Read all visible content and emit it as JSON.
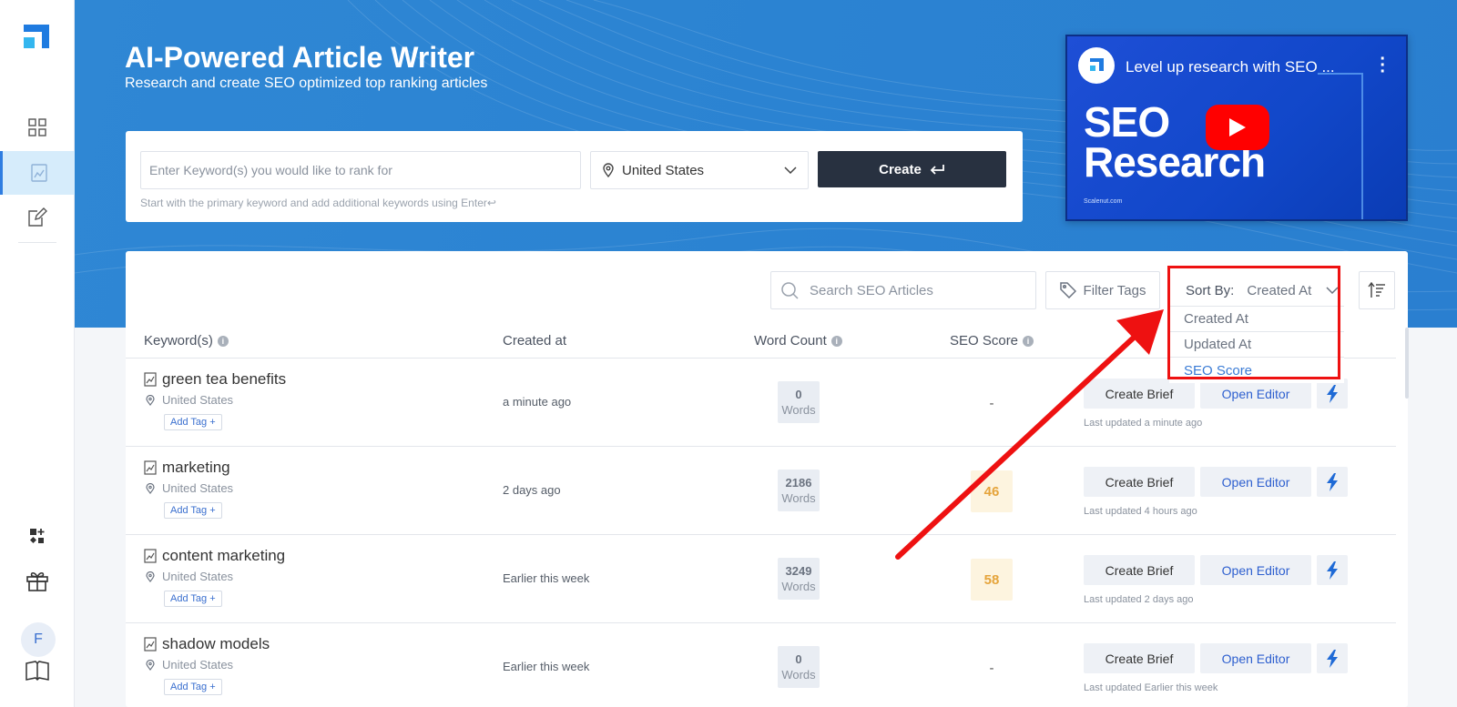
{
  "sidebar": {
    "items": [
      "dashboard",
      "ai-article-writer",
      "content-editor",
      "tools",
      "gift",
      "docs"
    ],
    "avatar": "F"
  },
  "hero": {
    "title": "AI-Powered Article Writer",
    "subtitle": "Research and create SEO optimized top ranking articles"
  },
  "create_form": {
    "keyword_placeholder": "Enter Keyword(s) you would like to rank for",
    "location": "United States",
    "create_label": "Create",
    "hint": "Start with the primary keyword and add additional keywords using Enter↩"
  },
  "video": {
    "title": "Level up research with SEO ...",
    "big_text_line1": "SEO",
    "big_text_line2": "Research",
    "small_text": "Scalenut.com",
    "channel_label": "nut"
  },
  "toolbar": {
    "search_placeholder": "Search SEO Articles",
    "filter_label": "Filter Tags",
    "sort_label": "Sort By:",
    "sort_value": "Created At",
    "sort_options": [
      "Created At",
      "Updated At",
      "SEO Score"
    ]
  },
  "table": {
    "headers": {
      "keyword": "Keyword(s)",
      "created": "Created at",
      "word_count": "Word Count",
      "seo_score": "SEO Score"
    },
    "add_tag_label": "Add Tag +",
    "words_label": "Words",
    "create_brief_label": "Create Brief",
    "open_editor_label": "Open Editor",
    "rows": [
      {
        "keyword": "green tea benefits",
        "location": "United States",
        "created": "a minute ago",
        "word_count": "0",
        "seo_score": "-",
        "updated": "Last updated a minute ago"
      },
      {
        "keyword": "marketing",
        "location": "United States",
        "created": "2 days ago",
        "word_count": "2186",
        "seo_score": "46",
        "updated": "Last updated 4 hours ago"
      },
      {
        "keyword": "content marketing",
        "location": "United States",
        "created": "Earlier this week",
        "word_count": "3249",
        "seo_score": "58",
        "updated": "Last updated 2 days ago"
      },
      {
        "keyword": "shadow models",
        "location": "United States",
        "created": "Earlier this week",
        "word_count": "0",
        "seo_score": "-",
        "updated": "Last updated Earlier this week"
      }
    ]
  },
  "colors": {
    "hero_blue": "#2b83d2",
    "dark_button": "#283140",
    "accent_blue": "#2f7de1",
    "score_orange": "#e5a43b",
    "annotation_red": "#ee1111"
  }
}
